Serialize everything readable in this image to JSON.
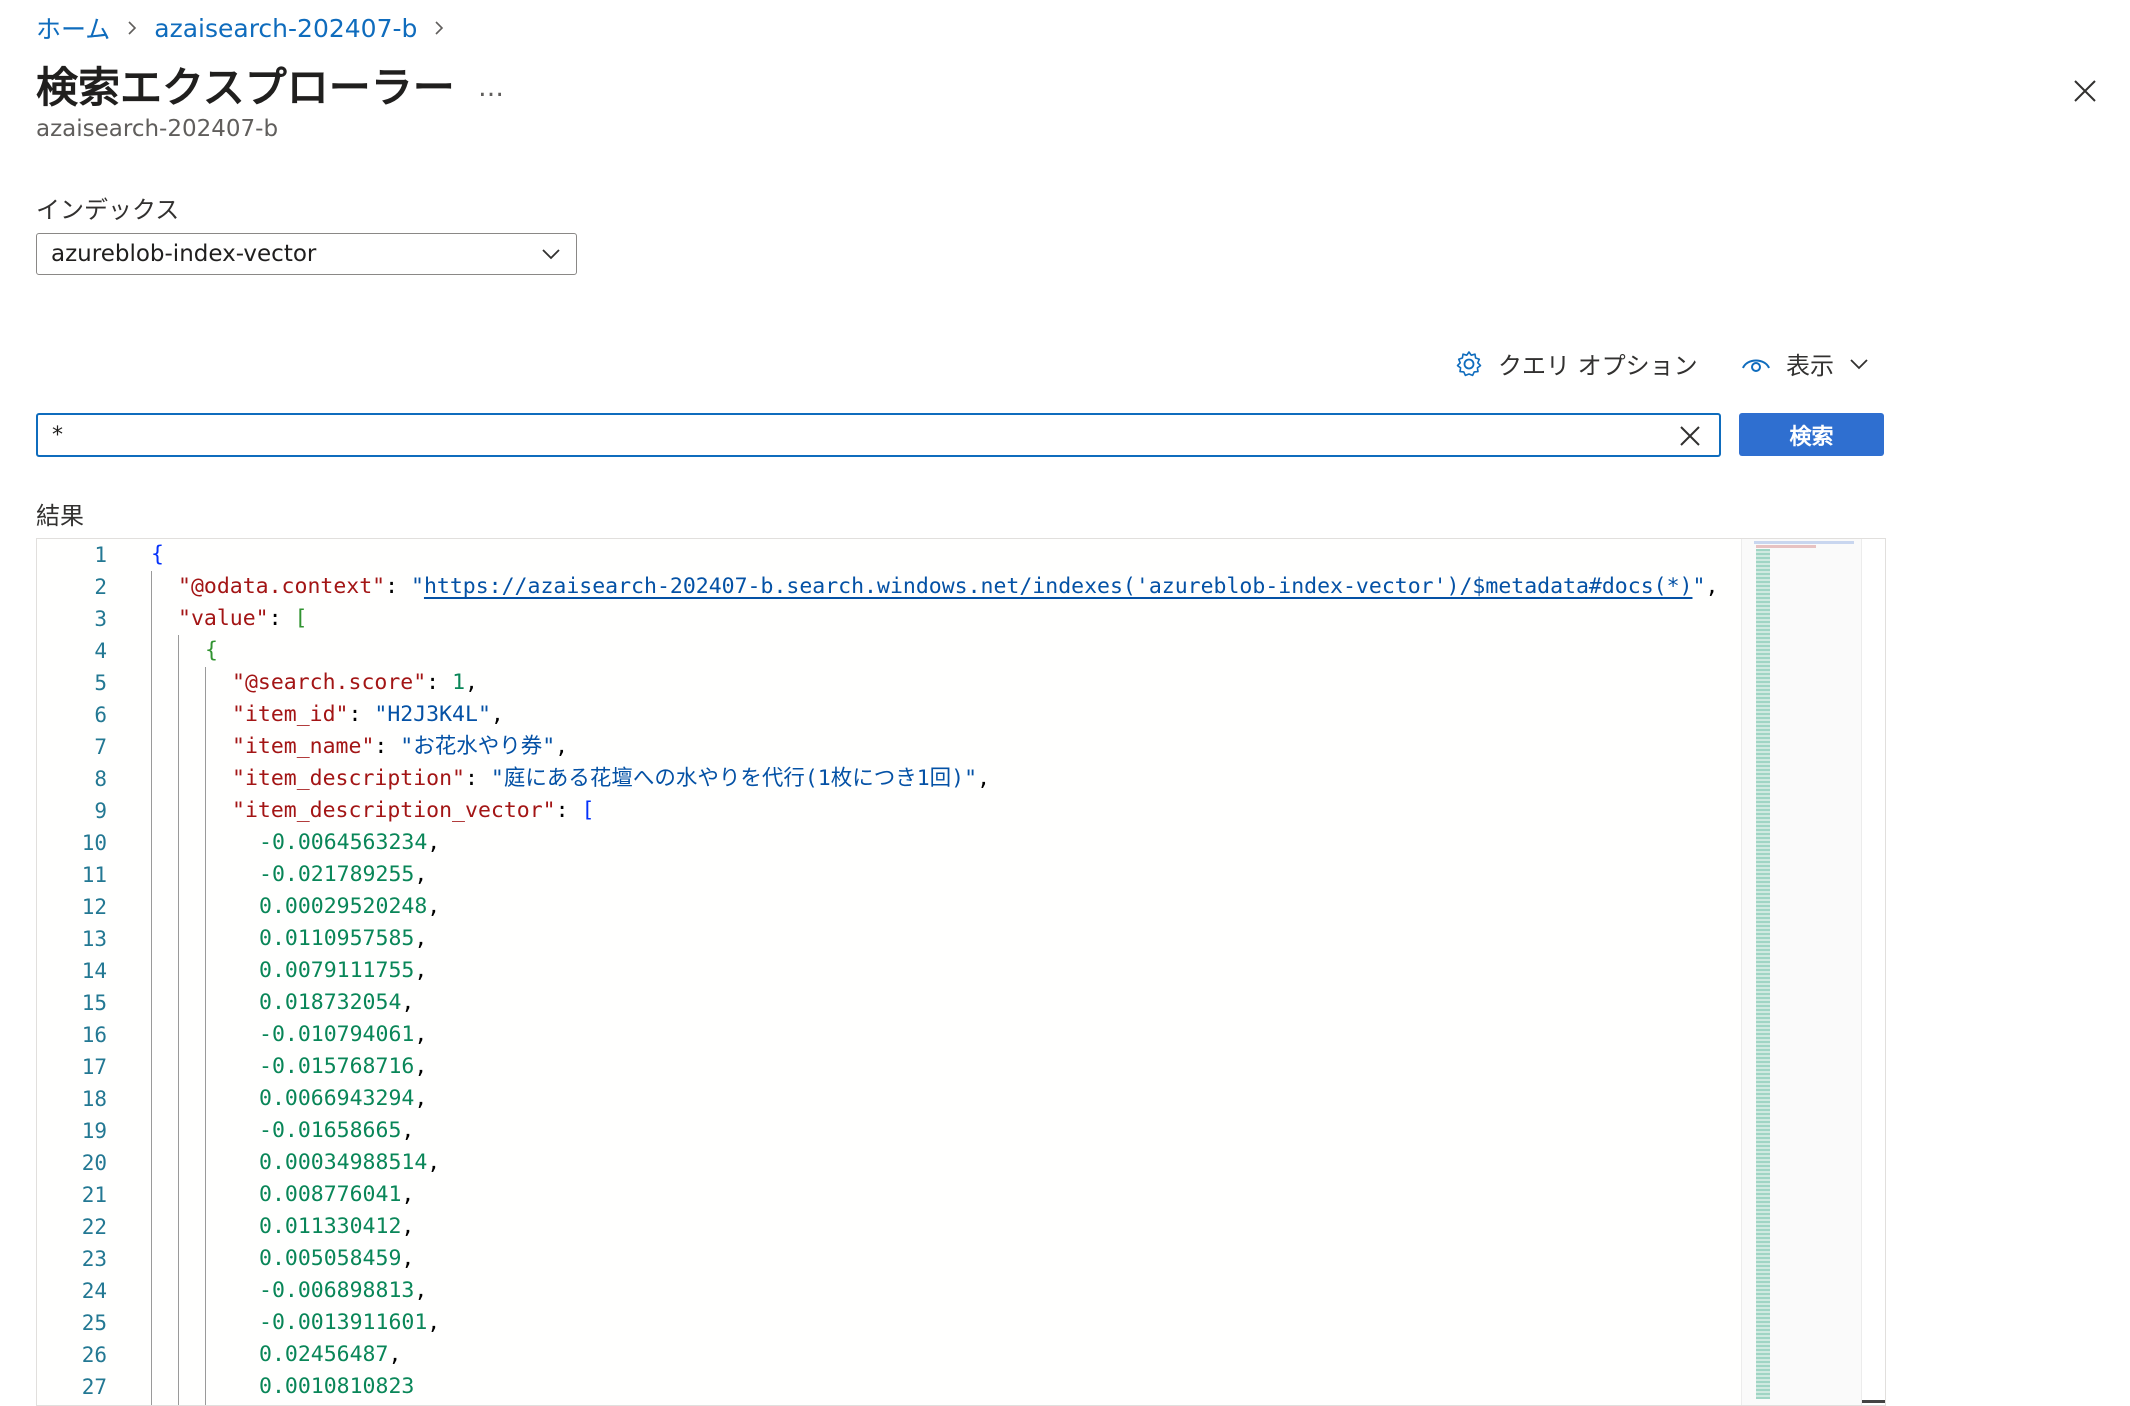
{
  "breadcrumb": {
    "items": [
      {
        "label": "ホーム"
      },
      {
        "label": "azaisearch-202407-b"
      }
    ]
  },
  "header": {
    "title": "検索エクスプローラー",
    "more": "…",
    "subtitle": "azaisearch-202407-b"
  },
  "index": {
    "label": "インデックス",
    "selected": "azureblob-index-vector"
  },
  "toolbar": {
    "query_options_label": "クエリ オプション",
    "view_label": "表示"
  },
  "search": {
    "value": "*",
    "button_label": "検索"
  },
  "results": {
    "label": "結果",
    "line_numbers": [
      "1",
      "2",
      "3",
      "4",
      "5",
      "6",
      "7",
      "8",
      "9",
      "10",
      "11",
      "12",
      "13",
      "14",
      "15",
      "16",
      "17",
      "18",
      "19",
      "20",
      "21",
      "22",
      "23",
      "24",
      "25",
      "26",
      "27"
    ],
    "code": {
      "l2_key": "\"@odata.context\"",
      "l2_url": "https://azaisearch-202407-b.search.windows.net/indexes('azureblob-index-vector')/$metadata#docs(*)",
      "l3_key": "\"value\"",
      "l5_key": "\"@search.score\"",
      "l5_val": "1",
      "l6_key": "\"item_id\"",
      "l6_val": "\"H2J3K4L\"",
      "l7_key": "\"item_name\"",
      "l7_val": "\"お花水やり券\"",
      "l8_key": "\"item_description\"",
      "l8_val": "\"庭にある花壇への水やりを代行(1枚につき1回)\"",
      "l9_key": "\"item_description_vector\"",
      "vector_values": [
        "-0.0064563234",
        "-0.021789255",
        "0.00029520248",
        "0.0110957585",
        "0.0079111755",
        "0.018732054",
        "-0.010794061",
        "-0.015768716",
        "0.0066943294",
        "-0.01658665",
        "0.00034988514",
        "0.008776041",
        "0.011330412",
        "0.005058459",
        "-0.006898813",
        "-0.0013911601",
        "0.02456487",
        "0.0010810823"
      ]
    }
  }
}
